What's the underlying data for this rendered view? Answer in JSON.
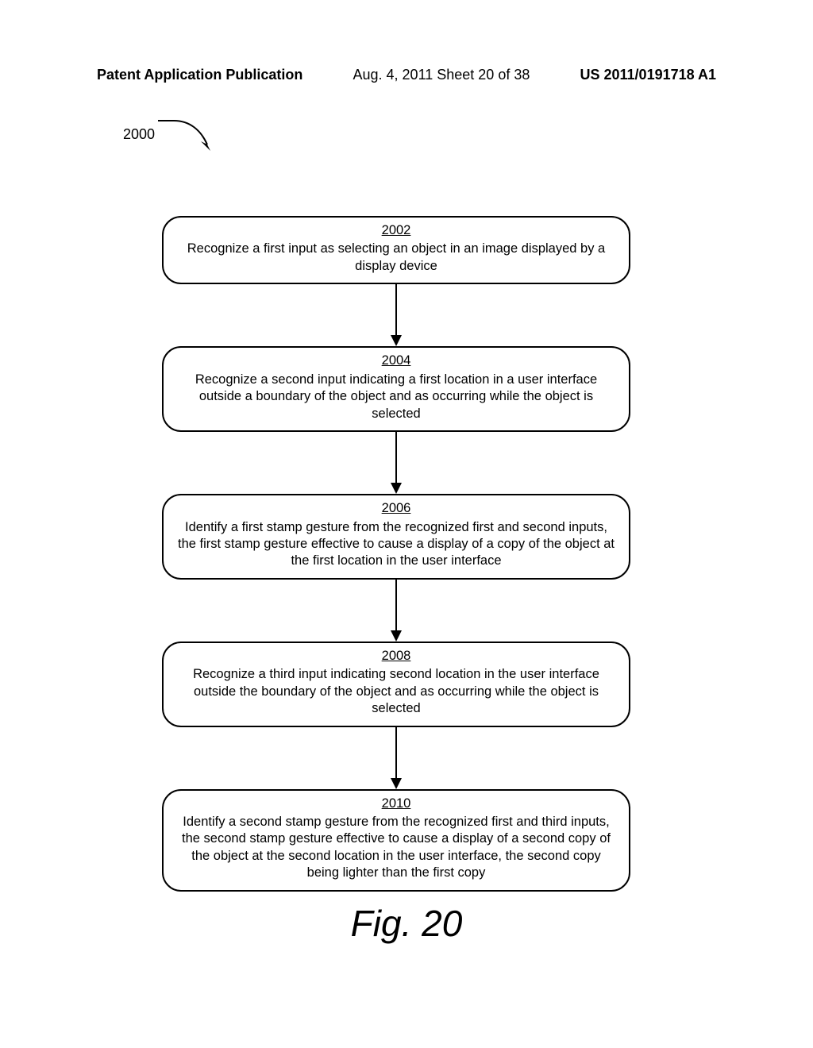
{
  "header": {
    "left": "Patent Application Publication",
    "center": "Aug. 4, 2011  Sheet 20 of 38",
    "right": "US 2011/0191718 A1"
  },
  "diagram": {
    "ref_number": "2000",
    "figure_caption": "Fig. 20",
    "steps": [
      {
        "num": "2002",
        "text": "Recognize a first input as selecting an object in an image displayed by a display device"
      },
      {
        "num": "2004",
        "text": "Recognize a second input indicating a first location in a user interface outside a boundary of the object and as occurring while the object is selected"
      },
      {
        "num": "2006",
        "text": "Identify a first stamp gesture from the recognized first and second inputs, the first stamp gesture effective to cause a display of a copy of the object at the first location in the user interface"
      },
      {
        "num": "2008",
        "text": "Recognize a third input indicating second location in the user interface outside the boundary of the object and as occurring while the object is selected"
      },
      {
        "num": "2010",
        "text": "Identify a second stamp gesture from the recognized first and third inputs, the second stamp gesture effective to cause a display of a second copy of the object at the second location in the user interface, the second copy being lighter than the first copy"
      }
    ]
  }
}
